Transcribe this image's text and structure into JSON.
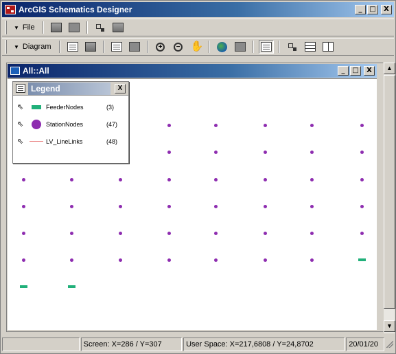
{
  "window": {
    "title": "ArcGIS Schematics Designer"
  },
  "window_buttons": {
    "minimize": "_",
    "maximize": "□",
    "close": "X"
  },
  "toolbar1": {
    "menu_label": "File",
    "tools": [
      "schematic-dataset-icon",
      "schematic-diagram-icon",
      "generate-icon",
      "properties-icon"
    ]
  },
  "toolbar2": {
    "menu_label": "Diagram",
    "tools": [
      "edit-icon",
      "save-icon",
      "update-icon",
      "layout-icon",
      "zoom-in-icon",
      "zoom-out-icon",
      "pan-icon",
      "globe-icon",
      "select-icon",
      "legend-icon",
      "tree-view-icon",
      "rows-view-icon",
      "split-view-icon"
    ]
  },
  "child_window": {
    "title": "All::All"
  },
  "legend": {
    "title": "Legend",
    "close": "X",
    "items": [
      {
        "name": "FeederNodes",
        "count": "(3)",
        "symbol": "feeder",
        "color": "#21b07a"
      },
      {
        "name": "StationNodes",
        "count": "(47)",
        "symbol": "station",
        "color": "#8e2db0"
      },
      {
        "name": "LV_LineLinks",
        "count": "(48)",
        "symbol": "line",
        "color": "#e66a6a"
      }
    ]
  },
  "diagram": {
    "station_color": "#8e2db0",
    "feeder_color": "#21b07a",
    "grid_columns": 8,
    "grid_rows": 6
  },
  "statusbar": {
    "panel1": "",
    "screen": "Screen: X=286 / Y=307",
    "user_space": "User Space: X=217,6808 / Y=24,8702",
    "date": "20/01/20"
  }
}
